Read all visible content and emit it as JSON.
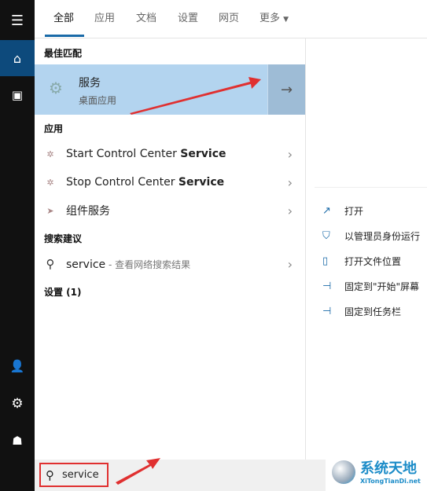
{
  "tabs": [
    {
      "label": "全部",
      "active": true
    },
    {
      "label": "应用"
    },
    {
      "label": "文档"
    },
    {
      "label": "设置"
    },
    {
      "label": "网页"
    },
    {
      "label": "更多"
    }
  ],
  "sections": {
    "best": "最佳匹配",
    "apps": "应用",
    "suggest": "搜索建议",
    "settings": "设置 (1)"
  },
  "best_match": {
    "title": "服务",
    "subtitle": "桌面应用"
  },
  "apps": [
    {
      "prefix": "Start Control Center ",
      "bold": "Service"
    },
    {
      "prefix": "Stop Control Center ",
      "bold": "Service"
    },
    {
      "prefix": "组件服务",
      "bold": ""
    }
  ],
  "suggestion": {
    "query": "service",
    "hint": " - 查看网络搜索结果"
  },
  "actions": [
    {
      "icon": "open-icon",
      "label": "打开"
    },
    {
      "icon": "shield-icon",
      "label": "以管理员身份运行"
    },
    {
      "icon": "folder-icon",
      "label": "打开文件位置"
    },
    {
      "icon": "pin-icon",
      "label": "固定到\"开始\"屏幕"
    },
    {
      "icon": "pin-icon",
      "label": "固定到任务栏"
    }
  ],
  "search": {
    "value": "service"
  },
  "watermark": {
    "text": "系统天地",
    "url": "XiTongTianDi.net"
  },
  "colors": {
    "accent": "#1a6aa8",
    "highlight": "#b3d4ef",
    "annotation": "#e03030"
  }
}
